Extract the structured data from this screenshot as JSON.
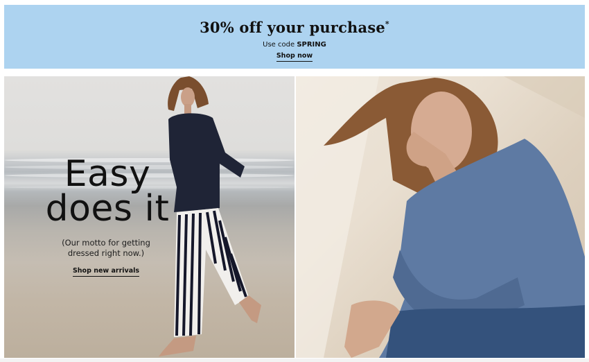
{
  "promo": {
    "headline": "30% off your purchase",
    "asterisk": "*",
    "code_prefix": "Use code ",
    "code": "SPRING",
    "link_label": "Shop now",
    "background_color": "#add3f0"
  },
  "hero": {
    "title_line1": "Easy",
    "title_line2": "does it",
    "subtitle_line1": "(Our motto for getting",
    "subtitle_line2": "dressed right now.)",
    "link_label": "Shop new arrivals"
  },
  "images": {
    "left": "woman-walking-beach-photo",
    "right": "woman-denim-shirt-portrait-photo"
  }
}
